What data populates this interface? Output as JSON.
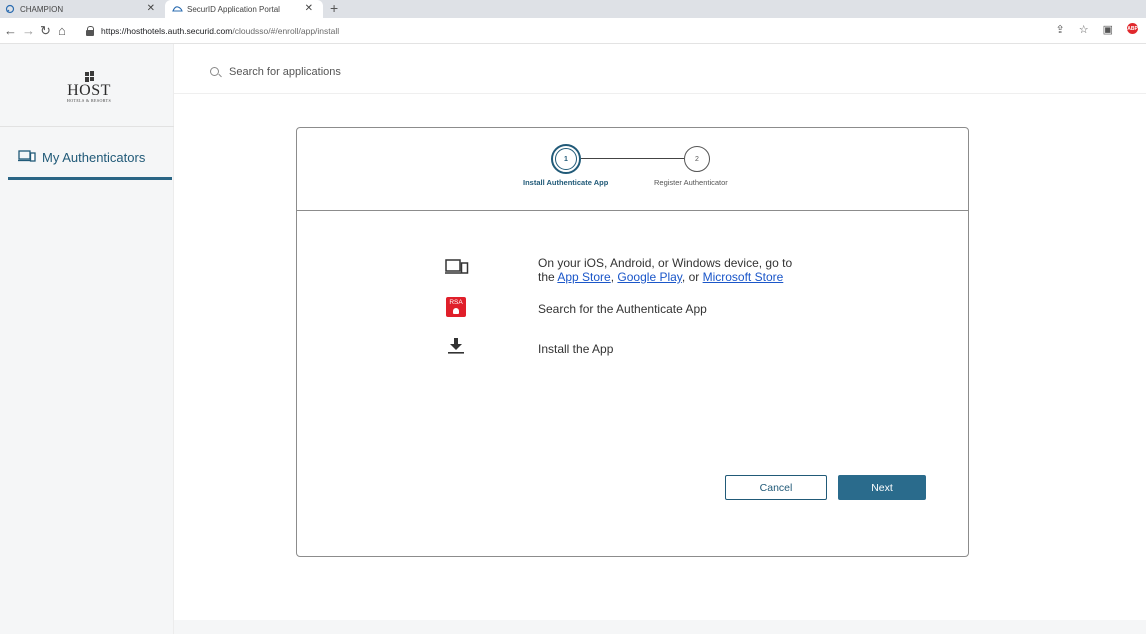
{
  "browser": {
    "tabs": [
      {
        "title": "CHAMPION",
        "icon": "champion-icon"
      },
      {
        "title": "SecurID Application Portal",
        "icon": "securid-icon"
      }
    ],
    "url_host": "https://hosthotels.auth.securid.com",
    "url_path": "/cloudsso/#/enroll/app/install"
  },
  "sidebar": {
    "logo_text": "HOST",
    "logo_sub": "HOTELS & RESORTS",
    "items": [
      {
        "label": "My Authenticators",
        "icon": "devices-icon"
      }
    ]
  },
  "search": {
    "placeholder": "Search for applications"
  },
  "wizard": {
    "steps": [
      {
        "number": "1",
        "label": "Install Authenticate App",
        "active": true
      },
      {
        "number": "2",
        "label": "Register Authenticator",
        "active": false
      }
    ],
    "instructions": [
      {
        "icon": "devices-icon",
        "text_prefix": "On your iOS, Android, or Windows device, go to",
        "text_the": "the",
        "link_app_store": "App Store",
        "sep1": ",",
        "link_google_play": "Google Play",
        "sep2": ", or",
        "link_microsoft_store": "Microsoft Store"
      },
      {
        "icon": "rsa-app-icon",
        "text": "Search for the Authenticate App",
        "badge": "RSA"
      },
      {
        "icon": "download-icon",
        "text": "Install the App"
      }
    ],
    "cancel_label": "Cancel",
    "next_label": "Next"
  },
  "colors": {
    "accent": "#215a78",
    "primary_button": "#2a6b8c",
    "link": "#1a56c9",
    "rsa_red": "#e01f2a"
  }
}
